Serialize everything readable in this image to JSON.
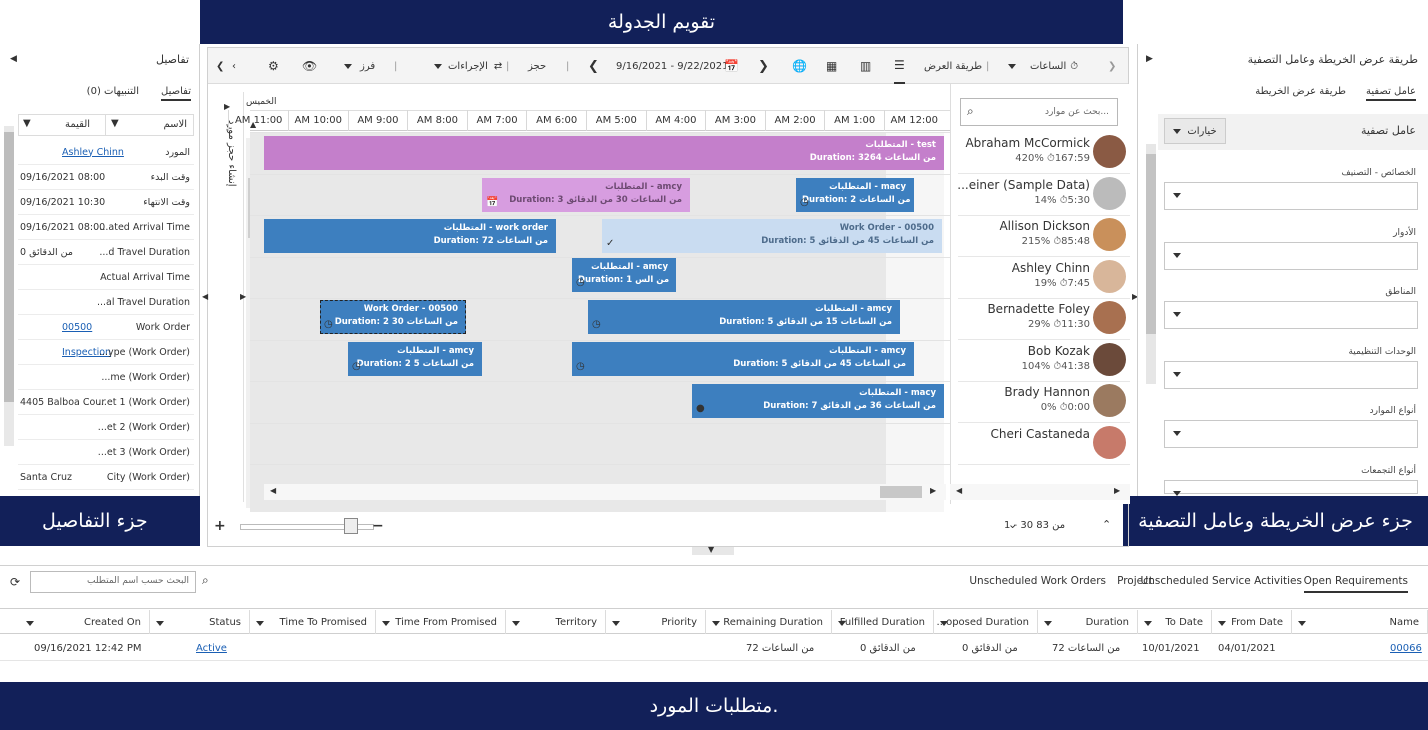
{
  "callouts": {
    "top": "تقويم الجدولة",
    "left": "جزء التفاصيل",
    "right": "جزء عرض الخريطة وعامل التصفية",
    "bottom": "متطلبات المورد."
  },
  "details": {
    "title": "تفاصيل",
    "tab_details": "تفاصيل",
    "tab_alerts": "التنبيهات (0)",
    "col_name": "الاسم",
    "col_value": "القيمة",
    "rows": [
      {
        "k": "المورد",
        "v": "Ashley Chinn"
      },
      {
        "k": "وقت البدء",
        "v": "09/16/2021 08:00"
      },
      {
        "k": "وقت الانتهاء",
        "v": "09/16/2021 10:30"
      },
      {
        "k": "...ated Arrival Time",
        "v": "09/16/2021 08:00"
      },
      {
        "k": "...d Travel Duration",
        "v": "0 من الدقائق"
      },
      {
        "k": "Actual Arrival Time",
        "v": ""
      },
      {
        "k": "...al Travel Duration",
        "v": ""
      },
      {
        "k": "Work Order",
        "v": "00500"
      },
      {
        "k": "...ype (Work Order)",
        "v": "Inspection"
      },
      {
        "k": "...me (Work Order)",
        "v": ""
      },
      {
        "k": "...et 1 (Work Order)",
        "v": "4405 Balboa Court"
      },
      {
        "k": "...et 2 (Work Order)",
        "v": ""
      },
      {
        "k": "...et 3 (Work Order)",
        "v": ""
      },
      {
        "k": "City (Work Order)",
        "v": "Santa Cruz"
      }
    ]
  },
  "toolbar": {
    "hours": "الساعات",
    "view_mode": "طريقة العرض",
    "date_range": "9/16/2021 - 9/22/2021",
    "book": "حجز",
    "actions": "الإجراءات",
    "sort": "فرز",
    "create_booking": "إنشاء حجز مورد",
    "thursday": "الخميس"
  },
  "hours": [
    "12:00 AM",
    "1:00 AM",
    "2:00 AM",
    "3:00 AM",
    "4:00 AM",
    "5:00 AM",
    "6:00 AM",
    "7:00 AM",
    "8:00 AM",
    "9:00 AM",
    "10:00 AM",
    "11:00 AM"
  ],
  "bookings": [
    {
      "title": "المتطلبات - test",
      "duration": "Duration: 3264 من الساعات"
    },
    {
      "title": "المتطلبات - amcy",
      "duration": "Duration: 3 من الساعات 30 من الدقائق"
    },
    {
      "title": "المتطلبات - macy",
      "duration": "Duration: 2 من الساعات"
    },
    {
      "title": "المتطلبات - work order",
      "duration": "Duration: 72 من الساعات"
    },
    {
      "title": "Work Order - 00500",
      "duration": "Duration: 5 من الساعات 45 من الدقائق"
    },
    {
      "title": "المتطلبات - amcy",
      "duration": "Duration: 1 من الس"
    },
    {
      "title": "Work Order - 00500",
      "duration": "Duration: 2 من الساعات 30"
    },
    {
      "title": "المتطلبات - amcy",
      "duration": "Duration: 5 من الساعات 15 من الدقائق"
    },
    {
      "title": "المتطلبات - amcy",
      "duration": "Duration: 2 من الساعات 5"
    },
    {
      "title": "المتطلبات - amcy",
      "duration": "Duration: 5 من الساعات 45 من الدقائق"
    },
    {
      "title": "المتطلبات - macy",
      "duration": "Duration: 7 من الساعات 36 من الدقائق"
    }
  ],
  "resources": {
    "search_placeholder": "بحث عن موارد...",
    "items": [
      {
        "name": "Abraham McCormick",
        "stats": "420%  ⏱167:59"
      },
      {
        "name": "...einer (Sample Data)",
        "stats": "14%  ⏱5:30"
      },
      {
        "name": "Allison Dickson",
        "stats": "215%  ⏱85:48"
      },
      {
        "name": "Ashley Chinn",
        "stats": "19%  ⏱7:45"
      },
      {
        "name": "Bernadette Foley",
        "stats": "29%  ⏱11:30"
      },
      {
        "name": "Bob Kozak",
        "stats": "104%  ⏱41:38"
      },
      {
        "name": "Brady Hannon",
        "stats": "0%  ⏱0:00"
      },
      {
        "name": "Cheri Castaneda",
        "stats": ""
      }
    ],
    "pager": "1 - 30 من 83"
  },
  "filter": {
    "title": "طريقة عرض الخريطة وعامل التصفية",
    "tab_filter": "عامل تصفية",
    "tab_map": "طريقة عرض الخريطة",
    "filter_heading": "عامل تصفية",
    "options": "خيارات",
    "labels": [
      "الخصائص - التصنيف",
      "الأدوار",
      "المناطق",
      "الوحدات التنظيمية",
      "أنواع الموارد",
      "أنواع التجمعات"
    ]
  },
  "bottom": {
    "search_placeholder": "البحث حسب اسم المتطلب",
    "tabs": [
      "Unscheduled Work Orders",
      "Project",
      "Unscheduled Service Activities",
      "Open Requirements"
    ],
    "columns": [
      "Name",
      "From Date",
      "To Date",
      "Duration",
      "...oposed Duration",
      "Fulfilled Duration",
      "Remaining Duration",
      "Priority",
      "Territory",
      "Time From Promised",
      "Time To Promised",
      "Status",
      "Created On"
    ],
    "row": {
      "name": "00066",
      "from": "04/01/2021",
      "to": "10/01/2021",
      "duration": "72 من الساعات",
      "proposed": "0 من الدقائق",
      "fulfilled": "0 من الدقائق",
      "remaining": "72 من الساعات",
      "status": "Active",
      "created": "09/16/2021 12:42 PM"
    }
  }
}
